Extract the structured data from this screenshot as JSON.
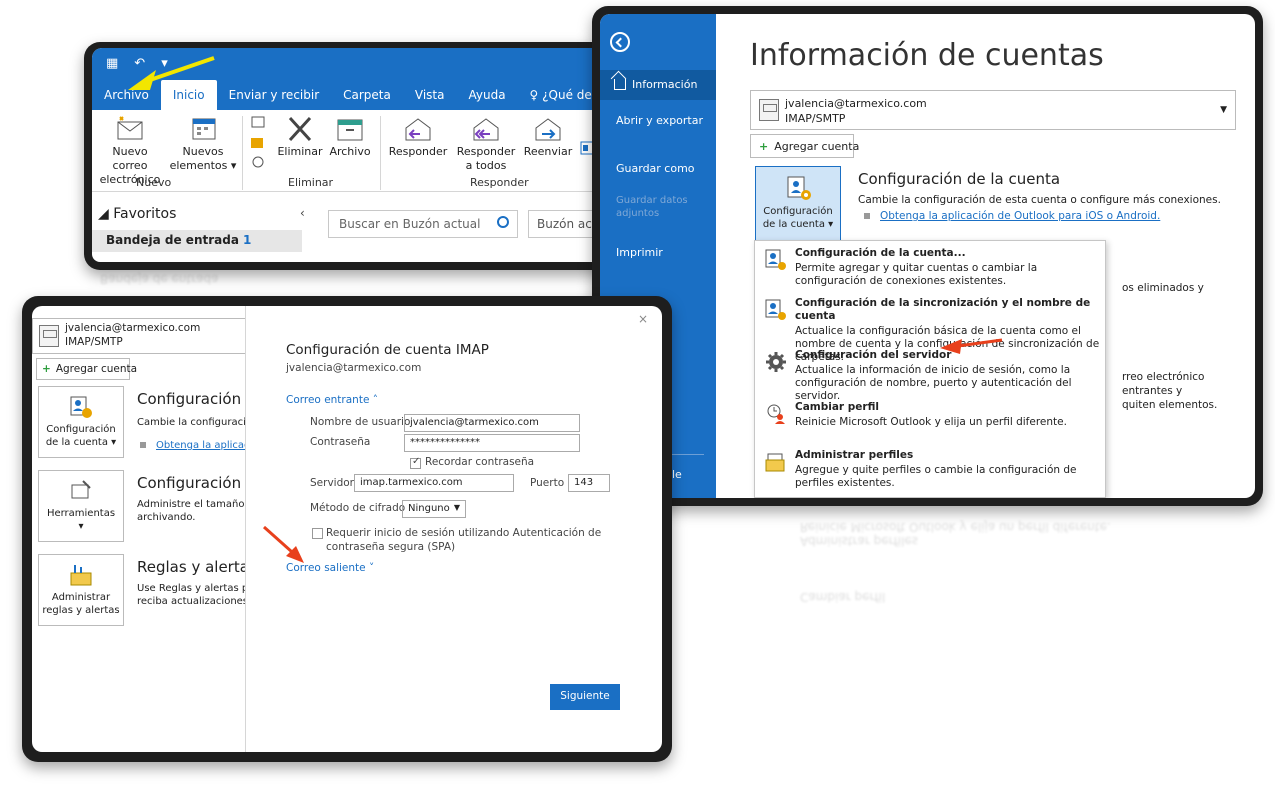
{
  "ribbon_window": {
    "tabs": [
      "Archivo",
      "Inicio",
      "Enviar y recibir",
      "Carpeta",
      "Vista",
      "Ayuda",
      "¿Qué dese"
    ],
    "active_tab": "Inicio",
    "buttons": {
      "new_mail": "Nuevo correo electrónico",
      "new_items": "Nuevos elementos",
      "delete": "Eliminar",
      "archive": "Archivo",
      "reply": "Responder",
      "reply_all": "Responder a todos",
      "forward": "Reenviar"
    },
    "groups": {
      "new": "Nuevo",
      "delete": "Eliminar",
      "respond": "Responder"
    },
    "favorites": "Favoritos",
    "inbox_label": "Bandeja de entrada",
    "inbox_count": "1",
    "search_placeholder": "Buscar en Buzón actual",
    "mailbox_scope": "Buzón actu"
  },
  "backstage": {
    "nav": {
      "info": "Información",
      "open_export": "Abrir y exportar",
      "save_as": "Guardar como",
      "save_attachments": "Guardar datos adjuntos",
      "print": "Imprimir",
      "partial": "le"
    },
    "title": "Información de cuentas",
    "account_email": "jvalencia@tarmexico.com",
    "account_type": "IMAP/SMTP",
    "add_account": "Agregar cuenta",
    "settings_button": "Configuración de la cuenta",
    "settings_title": "Configuración de la cuenta",
    "settings_desc": "Cambie la configuración de esta cuenta o configure más conexiones.",
    "settings_link": "Obtenga la aplicación de Outlook para iOS o Android.",
    "bg_text1": "os eliminados y",
    "bg_text2a": "rreo electrónico entrantes y",
    "bg_text2b": "quiten elementos.",
    "menu": [
      {
        "title": "Configuración de la cuenta...",
        "desc": "Permite agregar y quitar cuentas o cambiar la configuración de conexiones existentes."
      },
      {
        "title": "Configuración de la sincronización y el nombre de cuenta",
        "desc": "Actualice la configuración básica de la cuenta como el nombre de cuenta y la configuración de sincronización de carpetas."
      },
      {
        "title": "Configuración del servidor",
        "desc": "Actualice la información de inicio de sesión, como la configuración de nombre, puerto y autenticación del servidor."
      },
      {
        "title": "Cambiar perfil",
        "desc": "Reinicie Microsoft Outlook y elija un perfil diferente."
      },
      {
        "title": "Administrar perfiles",
        "desc": "Agregue y quite perfiles o cambie la configuración de perfiles existentes."
      }
    ]
  },
  "imap_window": {
    "left": {
      "account_email": "jvalencia@tarmexico.com",
      "account_type": "IMAP/SMTP",
      "add_account": "Agregar cuenta",
      "card_settings": "Configuración de la cuenta",
      "card_tools": "Herramientas",
      "card_rules": "Administrar reglas y alertas",
      "settings_title": "Configuración d",
      "settings_desc": "Cambie la configuración",
      "settings_link": "Obtenga la aplicació",
      "tools_title": "Configuración d",
      "tools_desc1": "Administre el tamaño de",
      "tools_desc2": "archivando.",
      "rules_title": "Reglas y alertas",
      "rules_desc1": "Use Reglas y alertas para",
      "rules_desc2": "reciba actualizaciones cu"
    },
    "right": {
      "title": "Configuración de cuenta IMAP",
      "email": "jvalencia@tarmexico.com",
      "incoming": "Correo entrante",
      "username_label": "Nombre de usuario",
      "username_value": "jvalencia@tarmexico.com",
      "password_label": "Contraseña",
      "password_value": "**************",
      "remember": "Recordar contraseña",
      "server_label": "Servidor",
      "server_value": "imap.tarmexico.com",
      "port_label": "Puerto",
      "port_value": "143",
      "encryption_label": "Método de cifrado",
      "encryption_value": "Ninguno",
      "spa": "Requerir inicio de sesión utilizando Autenticación de contraseña segura (SPA)",
      "outgoing": "Correo saliente",
      "next": "Siguiente"
    }
  },
  "colors": {
    "accent": "#1a6fc4",
    "arrow_red": "#e8401c",
    "arrow_yellow": "#f2e600"
  }
}
